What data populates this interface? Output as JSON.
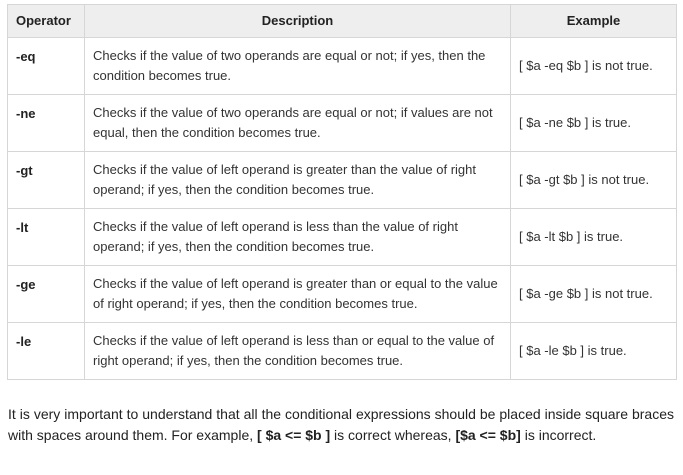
{
  "table": {
    "headers": {
      "operator": "Operator",
      "description": "Description",
      "example": "Example"
    },
    "rows": [
      {
        "operator": "-eq",
        "description": "Checks if the value of two operands are equal or not; if yes, then the condition becomes true.",
        "example": "[ $a -eq $b ] is not true."
      },
      {
        "operator": "-ne",
        "description": "Checks if the value of two operands are equal or not; if values are not equal, then the condition becomes true.",
        "example": "[ $a -ne $b ] is true."
      },
      {
        "operator": "-gt",
        "description": "Checks if the value of left operand is greater than the value of right operand; if yes, then the condition becomes true.",
        "example": "[ $a -gt $b ] is not true."
      },
      {
        "operator": "-lt",
        "description": "Checks if the value of left operand is less than the value of right operand; if yes, then the condition becomes true.",
        "example": "[ $a -lt $b ] is true."
      },
      {
        "operator": "-ge",
        "description": "Checks if the value of left operand is greater than or equal to the value of right operand; if yes, then the condition becomes true.",
        "example": "[ $a -ge $b ] is not true."
      },
      {
        "operator": "-le",
        "description": "Checks if the value of left operand is less than or equal to the value of right operand; if yes, then the condition becomes true.",
        "example": "[ $a -le $b ] is true."
      }
    ]
  },
  "note": {
    "text_before": "It is very important to understand that all the conditional expressions should be placed inside square braces with spaces around them. For example, ",
    "correct_example": "[ $a <= $b ]",
    "text_middle": " is correct whereas, ",
    "incorrect_example": "[$a <= $b]",
    "text_after": " is incorrect."
  },
  "colors": {
    "header_background": "#eeeeee",
    "border": "#d6d6d6",
    "text": "#222222"
  }
}
